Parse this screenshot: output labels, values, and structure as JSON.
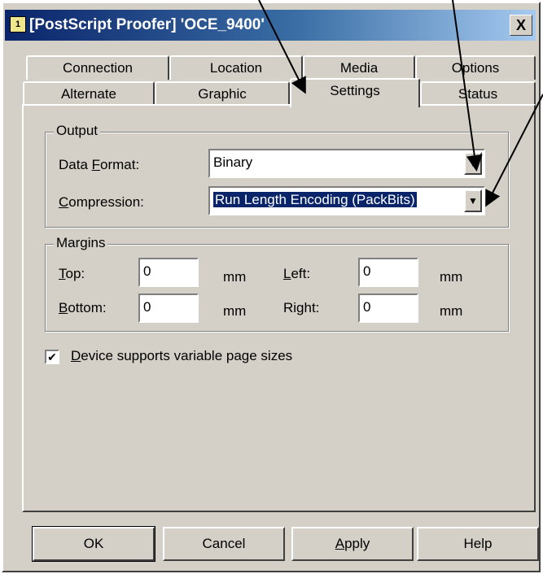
{
  "window": {
    "title": "[PostScript Proofer] 'OCE_9400'",
    "icon_name": "printer-icon",
    "close_label": "X"
  },
  "tabs": {
    "back_row": [
      "Connection",
      "Location",
      "Media",
      "Options"
    ],
    "front_row": [
      "Alternate",
      "Graphic",
      "Settings",
      "Status"
    ],
    "active": "Settings"
  },
  "output": {
    "legend": "Output",
    "data_format_label_pre": "Data ",
    "data_format_label_key": "F",
    "data_format_label_post": "ormat:",
    "data_format_value": "Binary",
    "compression_label_key": "C",
    "compression_label_post": "ompression:",
    "compression_value": "Run Length Encoding (PackBits)"
  },
  "margins": {
    "legend": "Margins",
    "top_key": "T",
    "top_post": "op:",
    "top_value": "0",
    "bottom_key": "B",
    "bottom_post": "ottom:",
    "bottom_value": "0",
    "left_key": "L",
    "left_post": "eft:",
    "left_value": "0",
    "right_label": "Right:",
    "right_value": "0",
    "unit": "mm"
  },
  "device": {
    "checked": true,
    "label_key": "D",
    "label_post": "evice supports variable page sizes"
  },
  "buttons": {
    "ok": "OK",
    "cancel": "Cancel",
    "apply_key": "A",
    "apply_post": "pply",
    "help": "Help"
  },
  "colors": {
    "title_gradient_start": "#0a246a",
    "dialog_face": "#d4d0c8",
    "selection": "#0a246a"
  }
}
